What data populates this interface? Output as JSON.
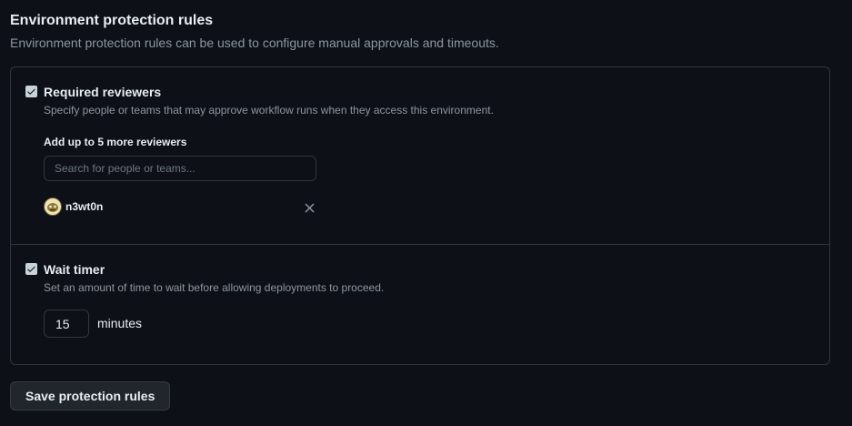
{
  "header": {
    "title": "Environment protection rules",
    "description": "Environment protection rules can be used to configure manual approvals and timeouts."
  },
  "required_reviewers": {
    "checked": true,
    "title": "Required reviewers",
    "description": "Specify people or teams that may approve workflow runs when they access this environment.",
    "add_label": "Add up to 5 more reviewers",
    "search_placeholder": "Search for people or teams...",
    "reviewers": [
      {
        "username": "n3wt0n",
        "avatar_icon": "avatar-icon"
      }
    ],
    "remove_icon": "close-icon"
  },
  "wait_timer": {
    "checked": true,
    "title": "Wait timer",
    "description": "Set an amount of time to wait before allowing deployments to proceed.",
    "minutes_value": "15",
    "minutes_label": "minutes"
  },
  "actions": {
    "save_label": "Save protection rules"
  },
  "colors": {
    "background": "#0d1117",
    "border": "#30363d",
    "text": "#e6edf3",
    "muted_text": "#8d96a0",
    "button_bg": "#21262d"
  }
}
